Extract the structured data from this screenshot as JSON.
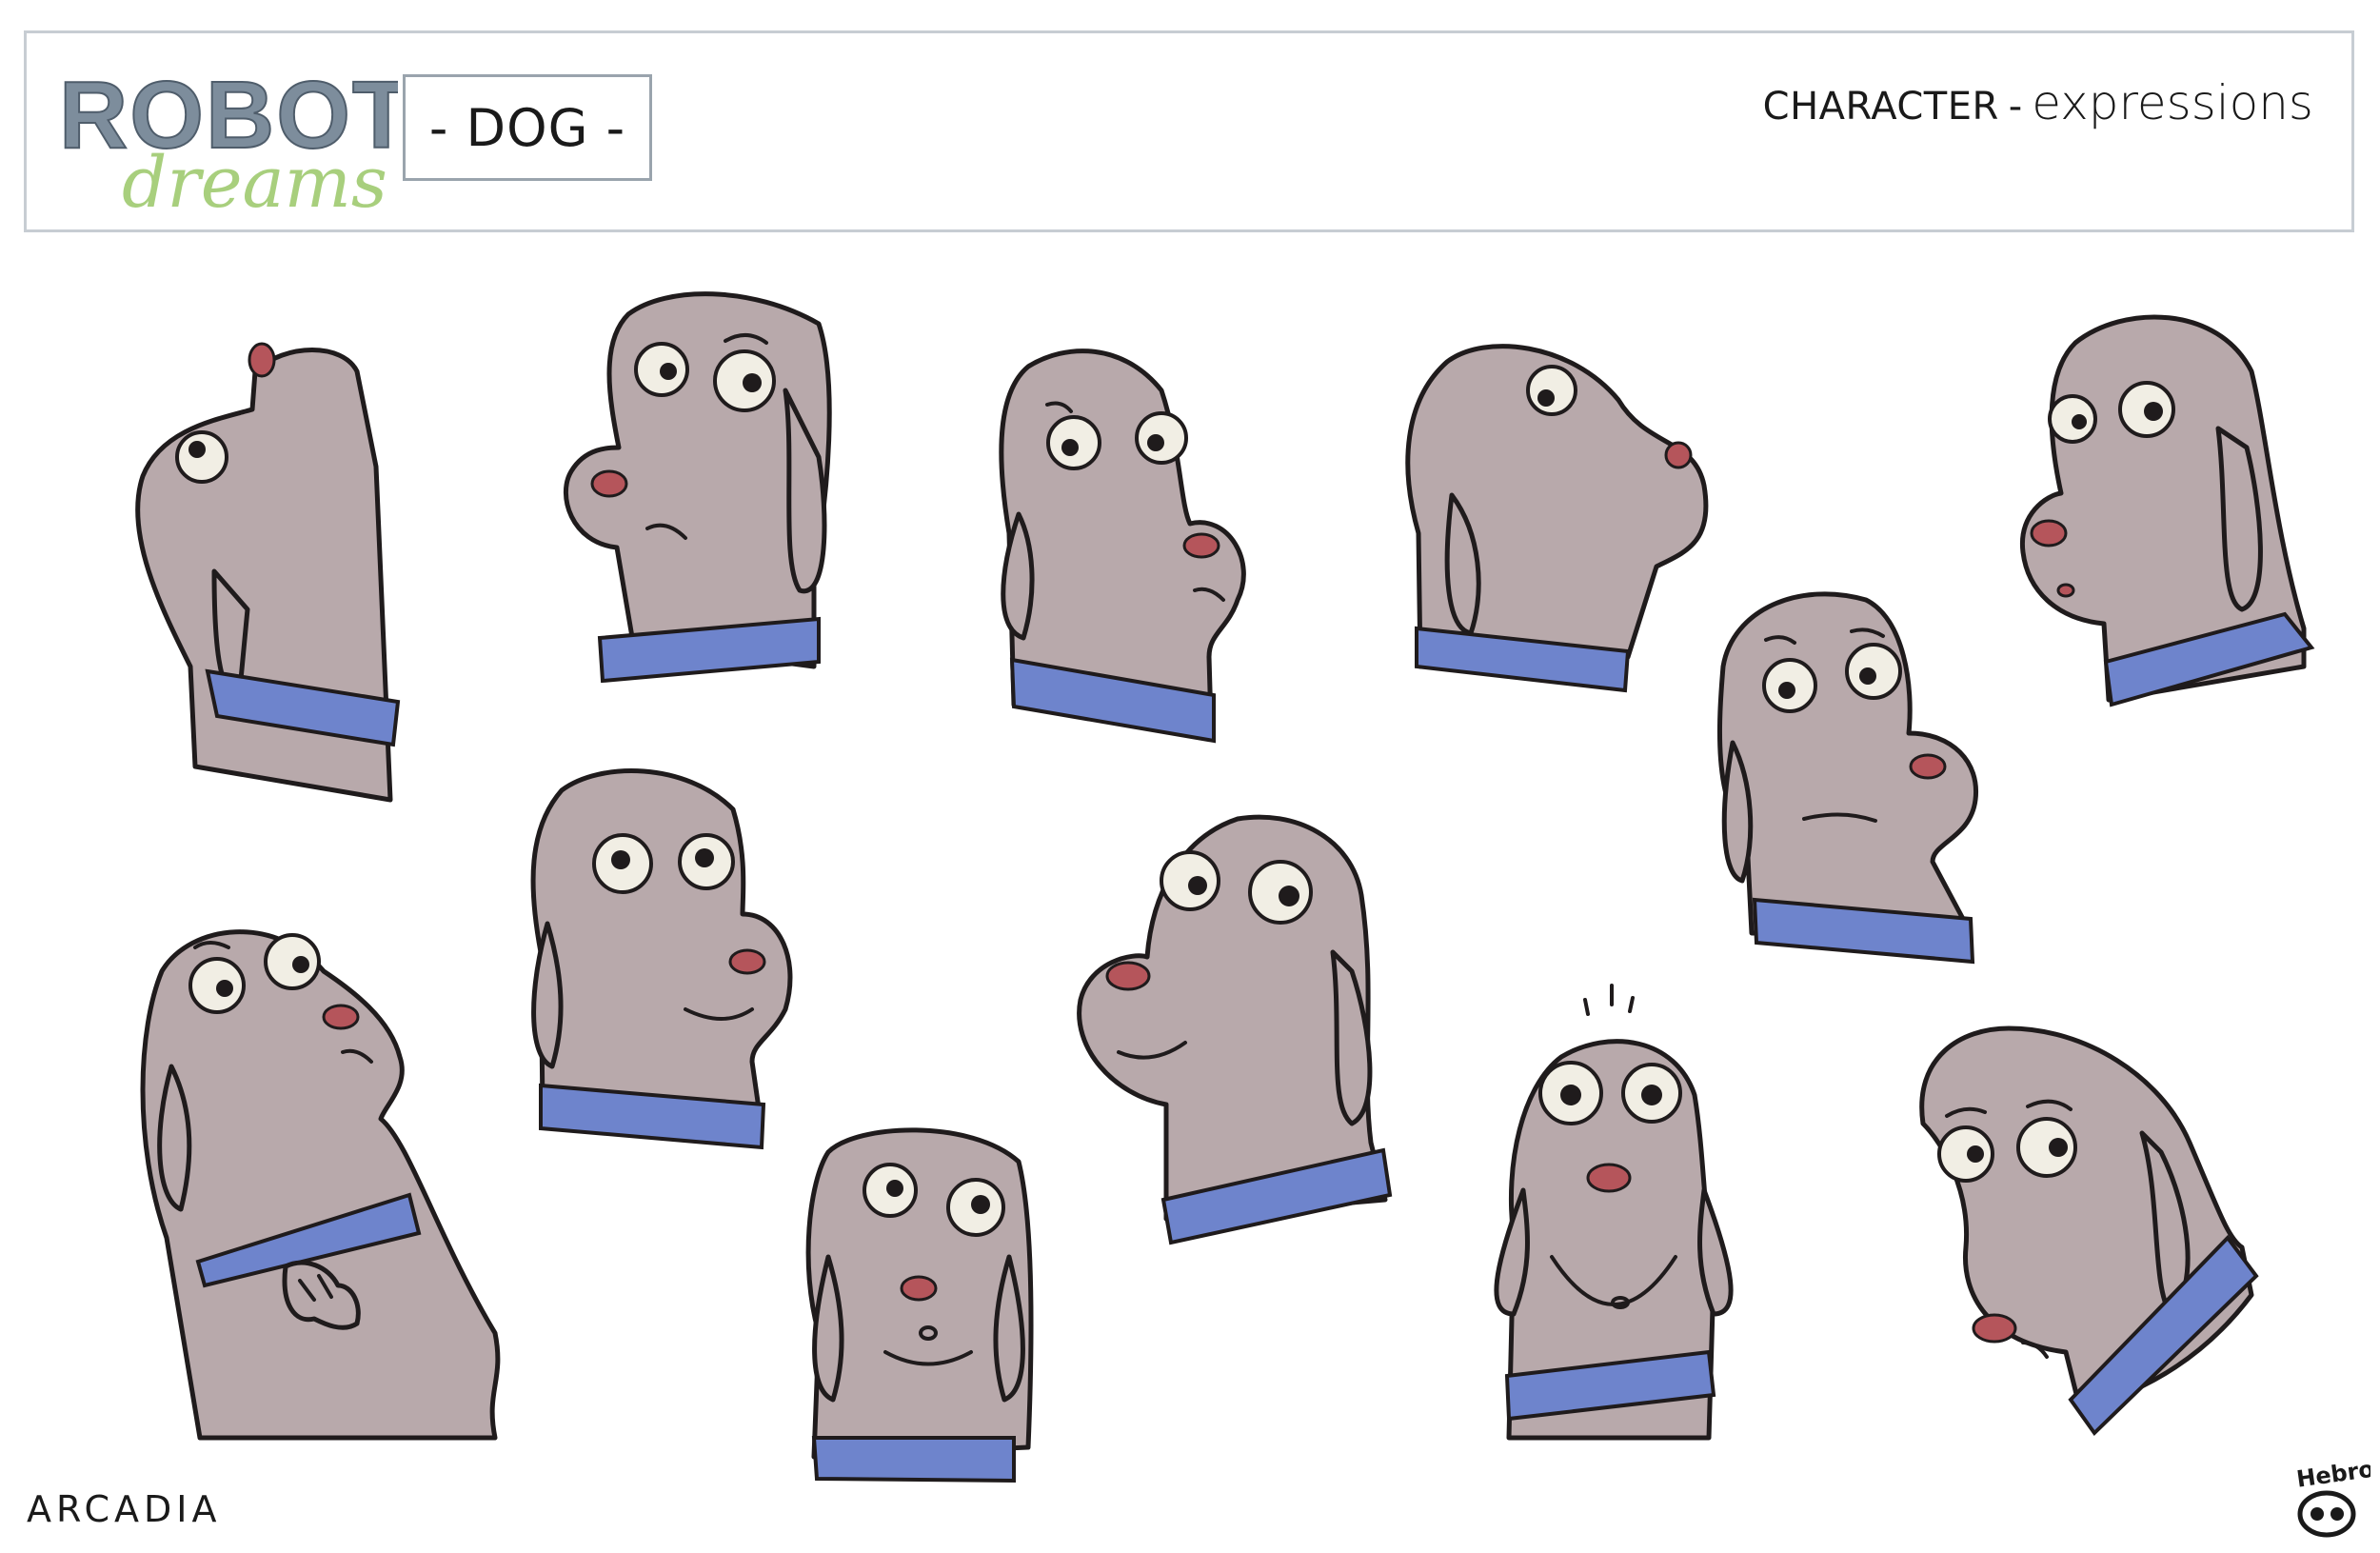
{
  "logo": {
    "line1": "ROBOT",
    "line2": "dreams"
  },
  "character_name": "- DOG -",
  "sheet_title": {
    "label": "CHARACTER",
    "separator": "-",
    "subtitle": "expressions"
  },
  "footer": {
    "studio": "ARCADIA",
    "signature": "Hebro"
  },
  "colors": {
    "dog_fur": "#b8a9ab",
    "collar": "#6e84cc",
    "nose": "#b5555b",
    "outline": "#1f1b1c",
    "logo_robot": "#7d8d9c",
    "logo_dreams": "#a8cf7d",
    "header_border": "#c7cdd3"
  },
  "expressions": [
    {
      "id": "looking-up-profile",
      "facing": "right",
      "pose": "up"
    },
    {
      "id": "worried-left",
      "facing": "left",
      "pose": "front"
    },
    {
      "id": "surprised-right",
      "facing": "right",
      "pose": "front"
    },
    {
      "id": "looking-up-back",
      "facing": "right",
      "pose": "up"
    },
    {
      "id": "startled-left",
      "facing": "left",
      "pose": "front"
    },
    {
      "id": "concerned-right",
      "facing": "right",
      "pose": "front"
    },
    {
      "id": "content-right",
      "facing": "right",
      "pose": "front"
    },
    {
      "id": "sad-hands",
      "facing": "right",
      "pose": "up"
    },
    {
      "id": "smiling-left",
      "facing": "left",
      "pose": "front"
    },
    {
      "id": "nervous-front",
      "facing": "front",
      "pose": "front"
    },
    {
      "id": "shocked-front",
      "facing": "front",
      "pose": "front"
    },
    {
      "id": "sad-down",
      "facing": "down",
      "pose": "down"
    }
  ]
}
